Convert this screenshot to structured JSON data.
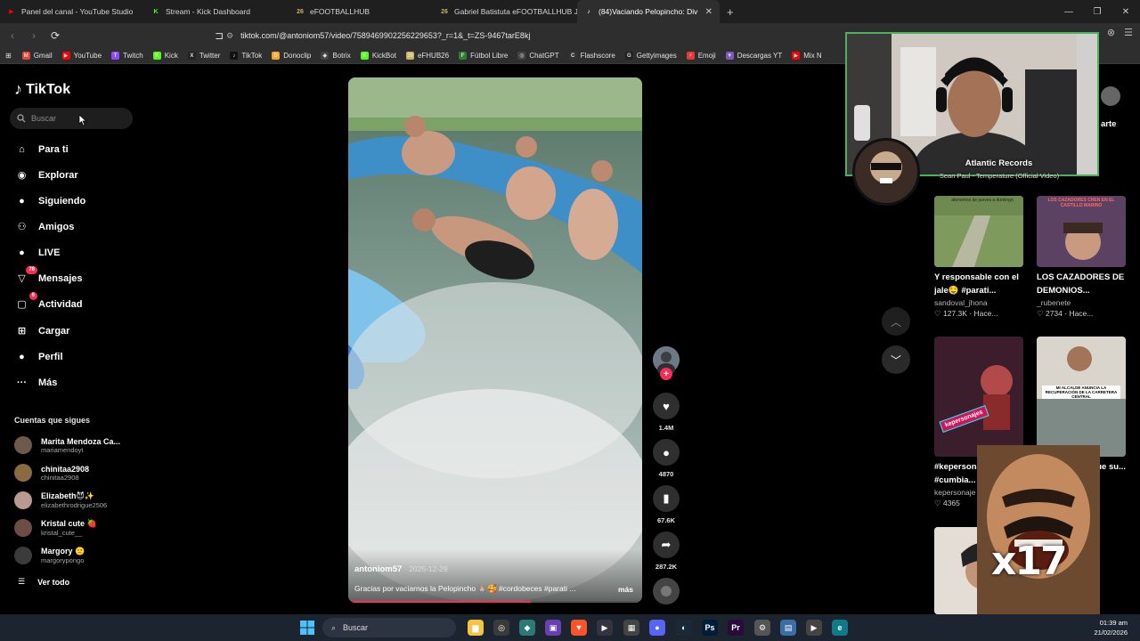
{
  "browser": {
    "tabs": [
      {
        "label": "Panel del canal - YouTube Studio",
        "color": "#ff0000",
        "glyph": "▶",
        "active": false
      },
      {
        "label": "Stream - Kick Dashboard",
        "color": "#53fc18",
        "glyph": "K",
        "active": false
      },
      {
        "label": "eFOOTBALLHUB",
        "color": "#c9b458",
        "glyph": "26",
        "active": false
      },
      {
        "label": "Gabriel Batistuta eFOOTBALLHUB Jug",
        "color": "#c9b458",
        "glyph": "26",
        "active": false
      },
      {
        "label": "(84)Vaciando Pelopincho: Div",
        "color": "#ffffff",
        "glyph": "♪",
        "active": true
      }
    ],
    "new_tab": "+",
    "url": "tiktok.com/@antoniom57/video/7589469902256229653?_r=1&_t=ZS-9467tarE8kj",
    "bookmarks": [
      {
        "label": "Gmail",
        "color": "#ea4335",
        "glyph": "M"
      },
      {
        "label": "YouTube",
        "color": "#ff0000",
        "glyph": "▶"
      },
      {
        "label": "Twitch",
        "color": "#9146ff",
        "glyph": "T"
      },
      {
        "label": "Kick",
        "color": "#53fc18",
        "glyph": "K"
      },
      {
        "label": "Twitter",
        "color": "#222222",
        "glyph": "X"
      },
      {
        "label": "TikTok",
        "color": "#111111",
        "glyph": "♪"
      },
      {
        "label": "Donoclip",
        "color": "#f5a623",
        "glyph": "D"
      },
      {
        "label": "Botrix",
        "color": "#444444",
        "glyph": "◆"
      },
      {
        "label": "KickBot",
        "color": "#53fc18",
        "glyph": "K"
      },
      {
        "label": "eFHUB26",
        "color": "#c9b458",
        "glyph": "26"
      },
      {
        "label": "Fútbol Libre",
        "color": "#2e7d32",
        "glyph": "F"
      },
      {
        "label": "ChatGPT",
        "color": "#444444",
        "glyph": "◎"
      },
      {
        "label": "Flashscore",
        "color": "#333333",
        "glyph": "C"
      },
      {
        "label": "Gettyimages",
        "color": "#222222",
        "glyph": "G"
      },
      {
        "label": "Emoji",
        "color": "#e53935",
        "glyph": "⚡"
      },
      {
        "label": "Descargas YT",
        "color": "#7e57c2",
        "glyph": "▼"
      },
      {
        "label": "Mix N",
        "color": "#ff0000",
        "glyph": "▶"
      }
    ]
  },
  "tiktok": {
    "logo": "TikTok",
    "search_placeholder": "Buscar",
    "nav": [
      {
        "label": "Para ti",
        "icon": "home-icon",
        "glyph": "⌂",
        "badge": ""
      },
      {
        "label": "Explorar",
        "icon": "compass-icon",
        "glyph": "◉",
        "badge": ""
      },
      {
        "label": "Siguiendo",
        "icon": "following-icon",
        "glyph": "●",
        "badge": ""
      },
      {
        "label": "Amigos",
        "icon": "friends-icon",
        "glyph": "⚇",
        "badge": ""
      },
      {
        "label": "LIVE",
        "icon": "live-icon",
        "glyph": "●",
        "badge": ""
      },
      {
        "label": "Mensajes",
        "icon": "messages-icon",
        "glyph": "▽",
        "badge": "78"
      },
      {
        "label": "Actividad",
        "icon": "activity-icon",
        "glyph": "▢",
        "badge": "6"
      },
      {
        "label": "Cargar",
        "icon": "upload-icon",
        "glyph": "⊞",
        "badge": ""
      },
      {
        "label": "Perfil",
        "icon": "profile-icon",
        "glyph": "●",
        "badge": ""
      },
      {
        "label": "Más",
        "icon": "more-icon",
        "glyph": "···",
        "badge": ""
      }
    ],
    "following_title": "Cuentas que sigues",
    "accounts": [
      {
        "name": "Marita Mendoza Ca...",
        "handle": "mariamendoyt",
        "color": "#6d5a4a"
      },
      {
        "name": "chinitaa2908",
        "handle": "chinitaa2908",
        "color": "#8a6a40"
      },
      {
        "name": "Elizabeth😈✨",
        "handle": "elizabethrodrigue2506",
        "color": "#b89a90"
      },
      {
        "name": "Kristal cute 🍓",
        "handle": "kristal_cute__",
        "color": "#6e4e44"
      },
      {
        "name": "Margory 🙂",
        "handle": "margorypongo",
        "color": "#3b3b3b"
      }
    ],
    "see_all": "Ver todo",
    "video": {
      "author": "antoniom57",
      "date": "· 2025-12-29",
      "caption": "Gracias por vaciarnos la Pelopincho 🙏🏼🥰 #cordobeces #parati ...",
      "more": "más",
      "progress": 0.62
    },
    "actions": {
      "likes": "1.4M",
      "comments": "4870",
      "saves": "67.6K",
      "shares": "287.2K"
    },
    "right_partial_label": "arte",
    "cards": [
      {
        "title": "Y responsable con el jale🤤 #parati...",
        "user": "sandoval_jhona",
        "stats": "♡ 127.3K · Hace...",
        "thumb_text": "atenemos de jueves a domingo"
      },
      {
        "title": "LOS CAZADORES DE DEMONIOS...",
        "user": "_rubenete",
        "stats": "♡ 2734 · Hace...",
        "thumb_text": "LOS CAZADORES CREN EN EL CASTILLO MARINO"
      },
      {
        "title": "#kepersonaje #cumbia...",
        "user": "kepersonaje",
        "stats": "♡ 4365",
        "thumb_text": "kepersonajes"
      },
      {
        "title": "gue su...",
        "user": "",
        "stats": "",
        "thumb_text": "MI ALCALDE ANUNCIA LA RECUPERACIÓN DE LA CARRETERA CENTRAL"
      }
    ]
  },
  "overlays": {
    "now_playing_artist": "Atlantic Records",
    "now_playing_track": "Sean Paul - Temperature (Official Video)",
    "meme_text": "x17"
  },
  "taskbar": {
    "search": "Buscar",
    "time": "01:39 am",
    "date": "21/02/2026"
  }
}
